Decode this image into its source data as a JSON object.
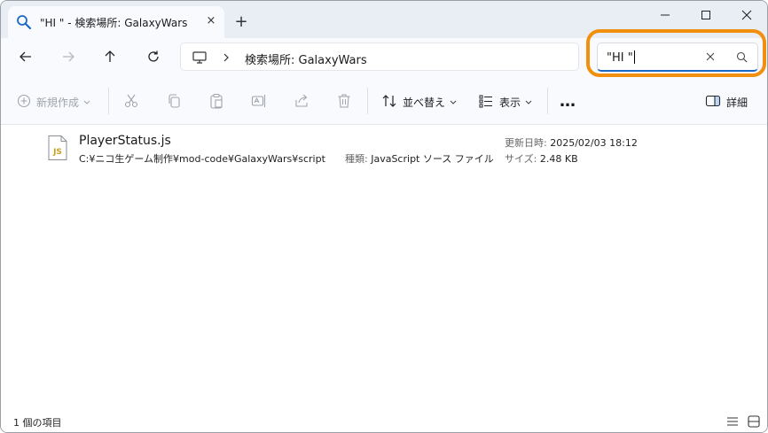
{
  "tab": {
    "title": "\"HI \" - 検索場所: GalaxyWars",
    "icon": "search-icon",
    "close_label": "×",
    "new_tab_label": "+"
  },
  "window_controls": {
    "minimize_icon": "minimize-icon",
    "maximize_icon": "maximize-icon",
    "close_icon": "close-icon"
  },
  "address_bar": {
    "location_icon": "computer-icon",
    "separator": "chevron-right-icon",
    "text": "検索場所: GalaxyWars"
  },
  "search": {
    "value": "\"HI \"",
    "highlight_color": "#f0900e"
  },
  "command_bar": {
    "new_label": "新規作成",
    "sort_label": "並べ替え",
    "view_label": "表示",
    "more_label": "…",
    "details_label": "詳細"
  },
  "results": [
    {
      "name": "PlayerStatus.js",
      "icon_label": "JS",
      "path": "C:¥ニコ生ゲーム制作¥mod-code¥GalaxyWars¥script",
      "type_label": "種類:",
      "type_value": "JavaScript ソース ファイル",
      "date_label": "更新日時:",
      "date_value": "2025/02/03 18:12",
      "size_label": "サイズ:",
      "size_value": "2.48 KB"
    }
  ],
  "status_bar": {
    "item_count": "1 個の項目"
  },
  "colors": {
    "accent": "#1a68c7",
    "js_icon": "#c9a21a",
    "highlight": "#f0900e"
  }
}
